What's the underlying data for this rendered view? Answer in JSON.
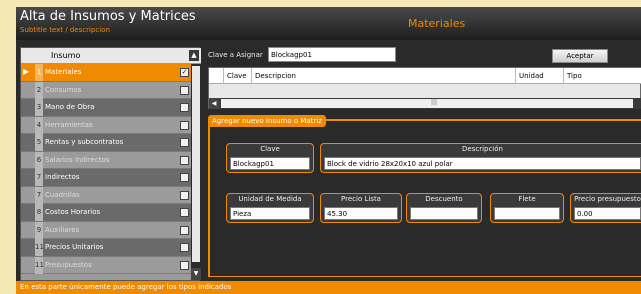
{
  "window": {
    "title": "Alta de Insumos y Matrices",
    "subtitle": "Subtitle text / descripcion",
    "section": "Materiales"
  },
  "left_list": {
    "header": "Insumo",
    "items": [
      {
        "num": "1",
        "label": "Materiales",
        "selected": true
      },
      {
        "num": "2",
        "label": "Consumos",
        "selected": false
      },
      {
        "num": "3",
        "label": "Mano de Obra",
        "selected": false
      },
      {
        "num": "4",
        "label": "Herramientas",
        "selected": false
      },
      {
        "num": "5",
        "label": "Rentas y subcontratos",
        "selected": false
      },
      {
        "num": "6",
        "label": "Salarios Indirectos",
        "selected": false
      },
      {
        "num": "7",
        "label": "Indirectos",
        "selected": false
      },
      {
        "num": "7",
        "label": "Cuadrillas",
        "selected": false
      },
      {
        "num": "8",
        "label": "Costos Horarios",
        "selected": false
      },
      {
        "num": "9",
        "label": "Auxiliares",
        "selected": false
      },
      {
        "num": "11",
        "label": "Precios Unitarios",
        "selected": false
      },
      {
        "num": "11",
        "label": "Presupuestos",
        "selected": false
      }
    ]
  },
  "top": {
    "clave_label": "Clave a Asignar",
    "clave_value": "Blockagp01",
    "accept_label": "Aceptar",
    "columns": [
      "Clave",
      "Descripcion",
      "Unidad",
      "Tipo"
    ]
  },
  "form": {
    "section_label": "Agregar nuevo Insumo o Matriz",
    "clave_label": "Clave",
    "clave_value": "Blockagp01",
    "descripcion_label": "Descripción",
    "descripcion_value": "Block de vidrio 28x20x10 azul polar",
    "unidad_label": "Unidad de Medida",
    "unidad_value": "Pieza",
    "precio_label": "Precio Lista",
    "precio_value": "45.30",
    "descuento_label": "Descuento",
    "descuento_value": "",
    "flete_label": "Flete",
    "flete_value": "",
    "presupuesto_label": "Precio presupuesto",
    "presupuesto_value": "0.00"
  },
  "status": {
    "text": "En esta parte únicamente puede agregar los tipos indicados"
  },
  "colors": {
    "accent": "#f08a00",
    "background": "#2a2a2a"
  }
}
